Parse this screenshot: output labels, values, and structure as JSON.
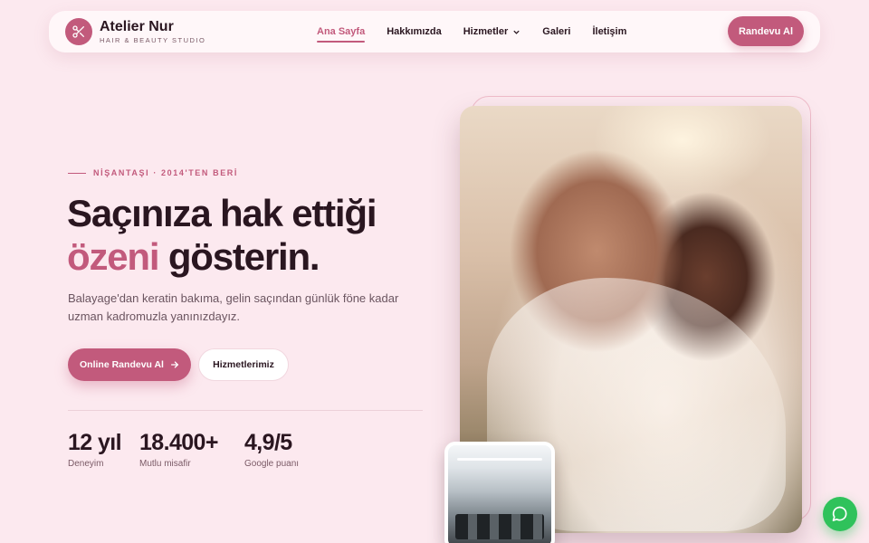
{
  "brand": {
    "name": "Atelier Nur",
    "tagline": "HAIR & BEAUTY STUDIO"
  },
  "nav": {
    "items": [
      {
        "label": "Ana Sayfa",
        "active": true
      },
      {
        "label": "Hakkımızda",
        "active": false
      },
      {
        "label": "Hizmetler",
        "active": false
      },
      {
        "label": "Galeri",
        "active": false
      },
      {
        "label": "İletişim",
        "active": false
      }
    ],
    "cta_label": "Randevu Al"
  },
  "hero": {
    "eyebrow": "NİŞANTAŞI · 2014'TEN BERİ",
    "headline_line1": "Saçınıza hak ettiği",
    "headline_accent": "özeni",
    "headline_line2_rest": " gösterin.",
    "lead": "Balayage'dan keratin bakıma, gelin saçından günlük föne kadar uzman kadromuzla yanınızdayız.",
    "primary_cta": "Online Randevu Al",
    "secondary_cta": "Hizmetlerimiz"
  },
  "stats": [
    {
      "value": "12 yıl",
      "label": "Deneyim"
    },
    {
      "value": "18.400+",
      "label": "Mutlu misafir"
    },
    {
      "value": "4,9/5",
      "label": "Google puanı"
    }
  ],
  "colors": {
    "background": "#fce9ef",
    "accent": "#c25a7c",
    "text": "#2a1620",
    "chat": "#2fc25b"
  },
  "icons": {
    "logo": "scissors-icon",
    "dropdown": "chevron-down-icon",
    "cta_arrow": "arrow-right-icon",
    "chat": "chat-bubble-icon"
  }
}
